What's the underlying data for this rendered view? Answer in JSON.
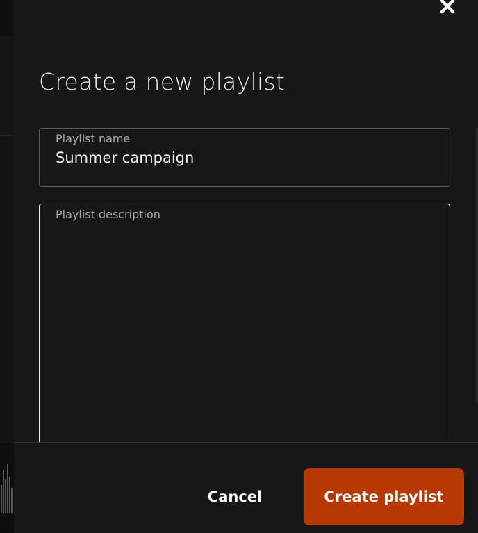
{
  "dialog": {
    "title": "Create a new playlist",
    "close_icon": "close-icon"
  },
  "form": {
    "name": {
      "label": "Playlist name",
      "value": "Summer campaign"
    },
    "description": {
      "label": "Playlist description",
      "value": ""
    }
  },
  "footer": {
    "cancel_label": "Cancel",
    "create_label": "Create playlist"
  },
  "colors": {
    "dialog_background": "#171717",
    "accent": "#b63904",
    "text_primary": "#f2f2f2",
    "text_muted": "#a9a9a9"
  }
}
